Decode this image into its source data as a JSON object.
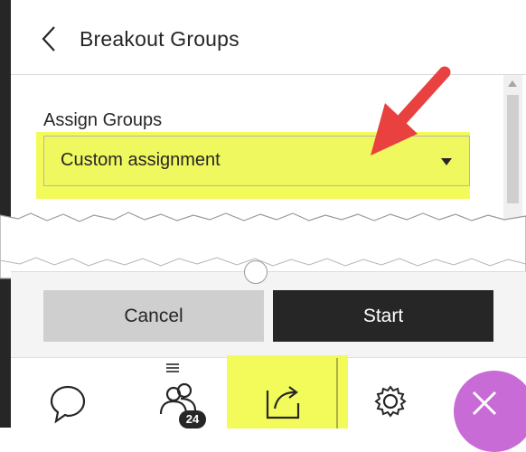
{
  "header": {
    "title": "Breakout Groups"
  },
  "form": {
    "assign_label": "Assign Groups",
    "assign_value": "Custom assignment"
  },
  "footer": {
    "cancel_label": "Cancel",
    "start_label": "Start"
  },
  "toolbar": {
    "participants_badge": "24",
    "items": [
      "chat",
      "participants",
      "share-content",
      "settings",
      "close"
    ]
  },
  "colors": {
    "highlight": "#f3fb5a",
    "annotation_arrow": "#e8413f",
    "start_button": "#262626",
    "close_button": "#c86bd6"
  }
}
